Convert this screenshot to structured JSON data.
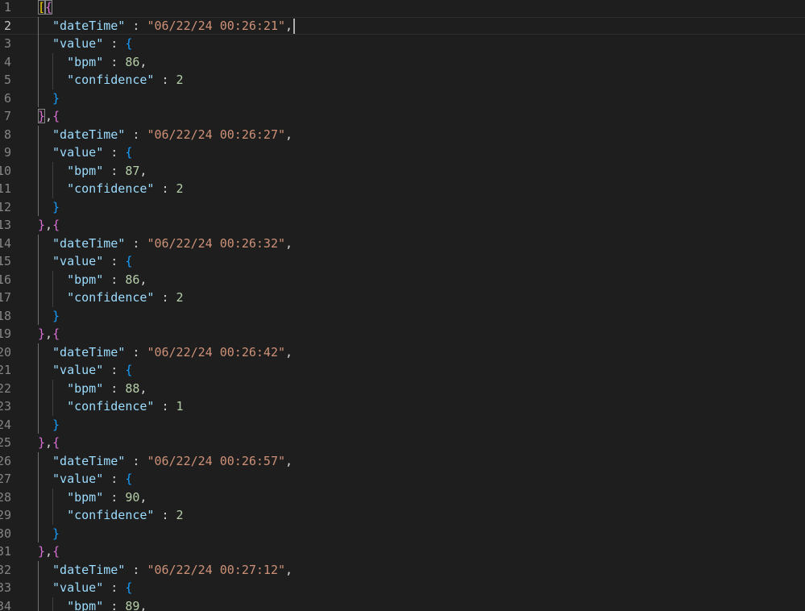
{
  "editor": {
    "language": "json",
    "active_line": 2,
    "colors": {
      "background": "#1e1e1e",
      "key": "#9cdcfe",
      "string": "#ce9178",
      "number": "#b5cea8",
      "bracket_gold": "#ffd700",
      "bracket_purple": "#da70d6",
      "bracket_blue": "#179fff"
    },
    "lines": [
      {
        "number": "1",
        "tokens": [
          {
            "t": "[",
            "c": "b1 bm"
          },
          {
            "t": "{",
            "c": "b2 bm"
          }
        ]
      },
      {
        "number": "2",
        "current": true,
        "indent": 1,
        "tokens": [
          {
            "t": "\"dateTime\"",
            "c": "k"
          },
          {
            "t": " : ",
            "c": "p"
          },
          {
            "t": "\"06/22/24 00:26:21\"",
            "c": "s"
          },
          {
            "t": ",",
            "c": "p"
          }
        ],
        "cursor": true
      },
      {
        "number": "3",
        "indent": 1,
        "tokens": [
          {
            "t": "\"value\"",
            "c": "k"
          },
          {
            "t": " : ",
            "c": "p"
          },
          {
            "t": "{",
            "c": "b3"
          }
        ]
      },
      {
        "number": "4",
        "indent": 2,
        "tokens": [
          {
            "t": "\"bpm\"",
            "c": "k"
          },
          {
            "t": " : ",
            "c": "p"
          },
          {
            "t": "86",
            "c": "n"
          },
          {
            "t": ",",
            "c": "p"
          }
        ]
      },
      {
        "number": "5",
        "indent": 2,
        "tokens": [
          {
            "t": "\"confidence\"",
            "c": "k"
          },
          {
            "t": " : ",
            "c": "p"
          },
          {
            "t": "2",
            "c": "n"
          }
        ]
      },
      {
        "number": "6",
        "indent": 1,
        "tokens": [
          {
            "t": "}",
            "c": "b3"
          }
        ]
      },
      {
        "number": "7",
        "tokens": [
          {
            "t": "}",
            "c": "b2 bm"
          },
          {
            "t": ",",
            "c": "p"
          },
          {
            "t": "{",
            "c": "b2"
          }
        ]
      },
      {
        "number": "8",
        "indent": 1,
        "tokens": [
          {
            "t": "\"dateTime\"",
            "c": "k"
          },
          {
            "t": " : ",
            "c": "p"
          },
          {
            "t": "\"06/22/24 00:26:27\"",
            "c": "s"
          },
          {
            "t": ",",
            "c": "p"
          }
        ]
      },
      {
        "number": "9",
        "indent": 1,
        "tokens": [
          {
            "t": "\"value\"",
            "c": "k"
          },
          {
            "t": " : ",
            "c": "p"
          },
          {
            "t": "{",
            "c": "b3"
          }
        ]
      },
      {
        "number": "10",
        "indent": 2,
        "tokens": [
          {
            "t": "\"bpm\"",
            "c": "k"
          },
          {
            "t": " : ",
            "c": "p"
          },
          {
            "t": "87",
            "c": "n"
          },
          {
            "t": ",",
            "c": "p"
          }
        ]
      },
      {
        "number": "11",
        "indent": 2,
        "tokens": [
          {
            "t": "\"confidence\"",
            "c": "k"
          },
          {
            "t": " : ",
            "c": "p"
          },
          {
            "t": "2",
            "c": "n"
          }
        ]
      },
      {
        "number": "12",
        "indent": 1,
        "tokens": [
          {
            "t": "}",
            "c": "b3"
          }
        ]
      },
      {
        "number": "13",
        "tokens": [
          {
            "t": "}",
            "c": "b2"
          },
          {
            "t": ",",
            "c": "p"
          },
          {
            "t": "{",
            "c": "b2"
          }
        ]
      },
      {
        "number": "14",
        "indent": 1,
        "tokens": [
          {
            "t": "\"dateTime\"",
            "c": "k"
          },
          {
            "t": " : ",
            "c": "p"
          },
          {
            "t": "\"06/22/24 00:26:32\"",
            "c": "s"
          },
          {
            "t": ",",
            "c": "p"
          }
        ]
      },
      {
        "number": "15",
        "indent": 1,
        "tokens": [
          {
            "t": "\"value\"",
            "c": "k"
          },
          {
            "t": " : ",
            "c": "p"
          },
          {
            "t": "{",
            "c": "b3"
          }
        ]
      },
      {
        "number": "16",
        "indent": 2,
        "tokens": [
          {
            "t": "\"bpm\"",
            "c": "k"
          },
          {
            "t": " : ",
            "c": "p"
          },
          {
            "t": "86",
            "c": "n"
          },
          {
            "t": ",",
            "c": "p"
          }
        ]
      },
      {
        "number": "17",
        "indent": 2,
        "tokens": [
          {
            "t": "\"confidence\"",
            "c": "k"
          },
          {
            "t": " : ",
            "c": "p"
          },
          {
            "t": "2",
            "c": "n"
          }
        ]
      },
      {
        "number": "18",
        "indent": 1,
        "tokens": [
          {
            "t": "}",
            "c": "b3"
          }
        ]
      },
      {
        "number": "19",
        "tokens": [
          {
            "t": "}",
            "c": "b2"
          },
          {
            "t": ",",
            "c": "p"
          },
          {
            "t": "{",
            "c": "b2"
          }
        ]
      },
      {
        "number": "20",
        "indent": 1,
        "tokens": [
          {
            "t": "\"dateTime\"",
            "c": "k"
          },
          {
            "t": " : ",
            "c": "p"
          },
          {
            "t": "\"06/22/24 00:26:42\"",
            "c": "s"
          },
          {
            "t": ",",
            "c": "p"
          }
        ]
      },
      {
        "number": "21",
        "indent": 1,
        "tokens": [
          {
            "t": "\"value\"",
            "c": "k"
          },
          {
            "t": " : ",
            "c": "p"
          },
          {
            "t": "{",
            "c": "b3"
          }
        ]
      },
      {
        "number": "22",
        "indent": 2,
        "tokens": [
          {
            "t": "\"bpm\"",
            "c": "k"
          },
          {
            "t": " : ",
            "c": "p"
          },
          {
            "t": "88",
            "c": "n"
          },
          {
            "t": ",",
            "c": "p"
          }
        ]
      },
      {
        "number": "23",
        "indent": 2,
        "tokens": [
          {
            "t": "\"confidence\"",
            "c": "k"
          },
          {
            "t": " : ",
            "c": "p"
          },
          {
            "t": "1",
            "c": "n"
          }
        ]
      },
      {
        "number": "24",
        "indent": 1,
        "tokens": [
          {
            "t": "}",
            "c": "b3"
          }
        ]
      },
      {
        "number": "25",
        "tokens": [
          {
            "t": "}",
            "c": "b2"
          },
          {
            "t": ",",
            "c": "p"
          },
          {
            "t": "{",
            "c": "b2"
          }
        ]
      },
      {
        "number": "26",
        "indent": 1,
        "tokens": [
          {
            "t": "\"dateTime\"",
            "c": "k"
          },
          {
            "t": " : ",
            "c": "p"
          },
          {
            "t": "\"06/22/24 00:26:57\"",
            "c": "s"
          },
          {
            "t": ",",
            "c": "p"
          }
        ]
      },
      {
        "number": "27",
        "indent": 1,
        "tokens": [
          {
            "t": "\"value\"",
            "c": "k"
          },
          {
            "t": " : ",
            "c": "p"
          },
          {
            "t": "{",
            "c": "b3"
          }
        ]
      },
      {
        "number": "28",
        "indent": 2,
        "tokens": [
          {
            "t": "\"bpm\"",
            "c": "k"
          },
          {
            "t": " : ",
            "c": "p"
          },
          {
            "t": "90",
            "c": "n"
          },
          {
            "t": ",",
            "c": "p"
          }
        ]
      },
      {
        "number": "29",
        "indent": 2,
        "tokens": [
          {
            "t": "\"confidence\"",
            "c": "k"
          },
          {
            "t": " : ",
            "c": "p"
          },
          {
            "t": "2",
            "c": "n"
          }
        ]
      },
      {
        "number": "30",
        "indent": 1,
        "tokens": [
          {
            "t": "}",
            "c": "b3"
          }
        ]
      },
      {
        "number": "31",
        "tokens": [
          {
            "t": "}",
            "c": "b2"
          },
          {
            "t": ",",
            "c": "p"
          },
          {
            "t": "{",
            "c": "b2"
          }
        ]
      },
      {
        "number": "32",
        "indent": 1,
        "tokens": [
          {
            "t": "\"dateTime\"",
            "c": "k"
          },
          {
            "t": " : ",
            "c": "p"
          },
          {
            "t": "\"06/22/24 00:27:12\"",
            "c": "s"
          },
          {
            "t": ",",
            "c": "p"
          }
        ]
      },
      {
        "number": "33",
        "indent": 1,
        "tokens": [
          {
            "t": "\"value\"",
            "c": "k"
          },
          {
            "t": " : ",
            "c": "p"
          },
          {
            "t": "{",
            "c": "b3"
          }
        ]
      },
      {
        "number": "34",
        "indent": 2,
        "tokens": [
          {
            "t": "\"bpm\"",
            "c": "k"
          },
          {
            "t": " : ",
            "c": "p"
          },
          {
            "t": "89",
            "c": "n"
          },
          {
            "t": ",",
            "c": "p"
          }
        ]
      }
    ]
  }
}
